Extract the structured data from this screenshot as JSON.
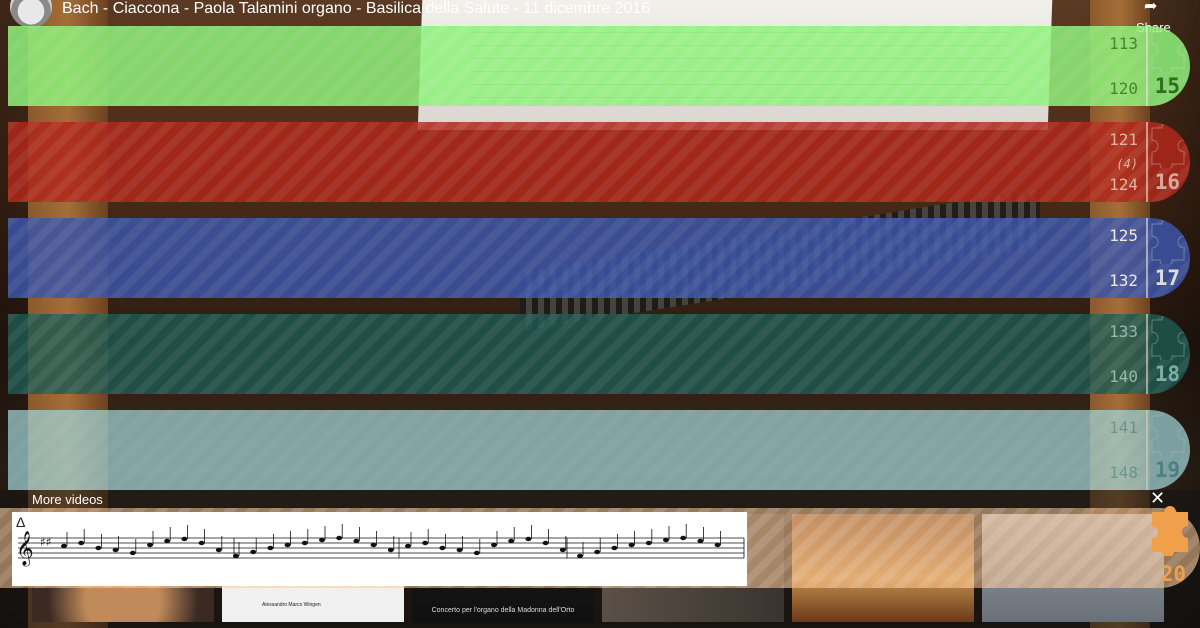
{
  "video": {
    "title": "Bach - Ciaccona - Paola Talamini organo - Basilica della Salute - 11 dicembre 2016",
    "share_label": "Share"
  },
  "sections": [
    {
      "start": "113",
      "end": "120",
      "repeat": "",
      "number": "15",
      "color": "#8ef27a",
      "text_color": "#3a8a2a",
      "num_color": "#2f7a20"
    },
    {
      "start": "121",
      "end": "124",
      "repeat": "(4)",
      "number": "16",
      "color": "#b0281a",
      "text_color": "#f2c0b8",
      "num_color": "#f2c0b8"
    },
    {
      "start": "125",
      "end": "132",
      "repeat": "",
      "number": "17",
      "color": "#3c55a8",
      "text_color": "#ffffff",
      "num_color": "#ffffff"
    },
    {
      "start": "133",
      "end": "140",
      "repeat": "",
      "number": "18",
      "color": "#1e5a52",
      "text_color": "#8fd0c8",
      "num_color": "#8fd0c8"
    },
    {
      "start": "141",
      "end": "148",
      "repeat": "",
      "number": "19",
      "color": "#9ed4d8",
      "text_color": "#5aa8ac",
      "num_color": "#5aa8ac"
    }
  ],
  "current_section": {
    "number": "20",
    "color": "#f0a04b"
  },
  "score": {
    "delta_symbol": "Δ"
  },
  "more_videos": {
    "label": "More videos",
    "close_icon": "✕",
    "thumbnails": [
      {
        "caption": "",
        "sublabel": ""
      },
      {
        "caption": "",
        "sublabel": "Alessandro Marco Wingen"
      },
      {
        "caption": "Concerto per l'organo della Madonna dell'Orto",
        "sublabel": ""
      },
      {
        "caption": "",
        "sublabel": ""
      },
      {
        "caption": "",
        "sublabel": ""
      },
      {
        "caption": "",
        "sublabel": ""
      }
    ]
  },
  "icons": {
    "share": "share-arrow-icon",
    "puzzle": "puzzle-piece-icon",
    "close": "close-icon"
  }
}
